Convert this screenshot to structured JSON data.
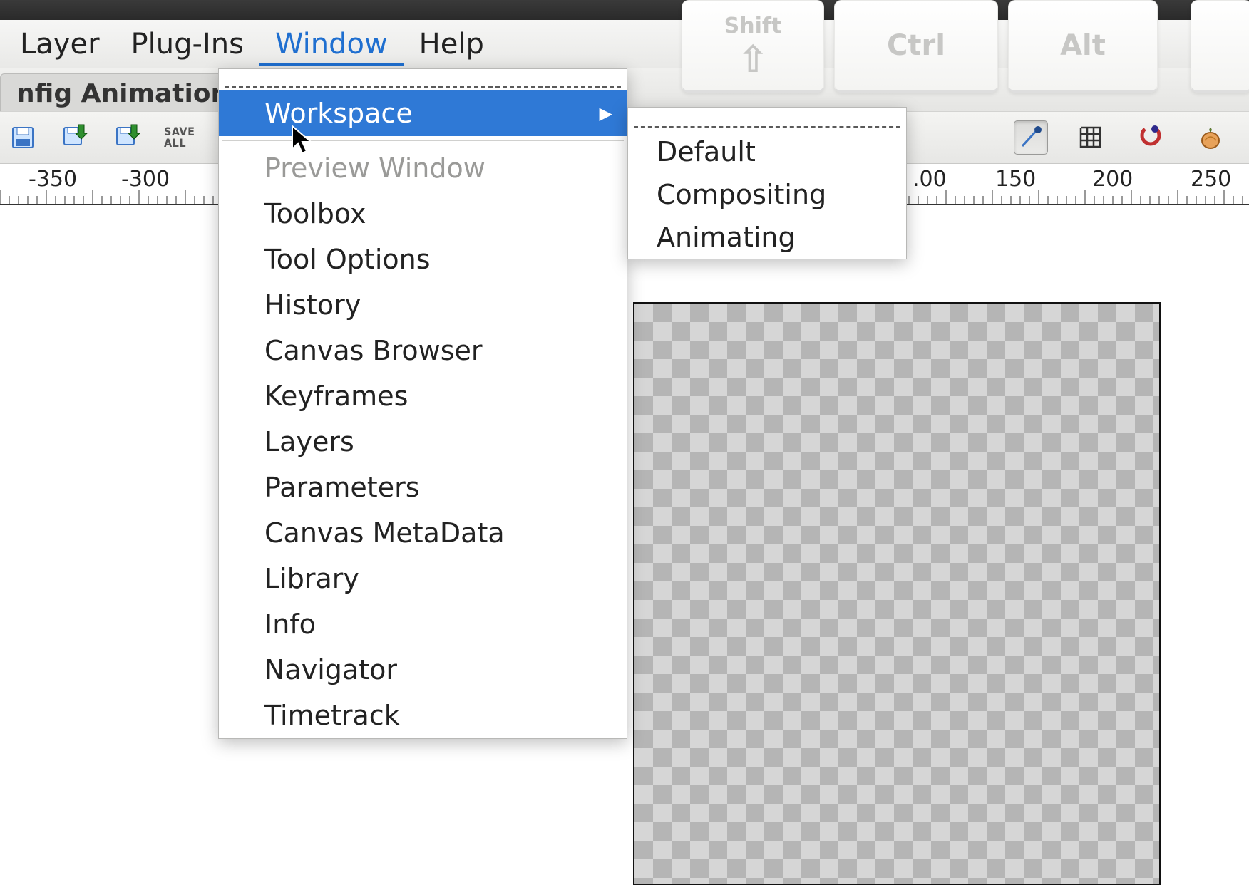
{
  "menubar": {
    "items": [
      "Layer",
      "Plug-Ins",
      "Window",
      "Help"
    ],
    "active_index": 2
  },
  "tabs": {
    "items": [
      "nfig Animation"
    ],
    "active_index": 0
  },
  "toolbar": {
    "save_all_label": "SAVE\nALL"
  },
  "modifier_keys": {
    "shift": "Shift",
    "ctrl": "Ctrl",
    "alt": "Alt"
  },
  "ruler": {
    "labels": [
      "-350",
      "-300",
      ".00",
      "150",
      "200",
      "250"
    ]
  },
  "window_menu": {
    "items": [
      {
        "label": "Workspace",
        "submenu": true,
        "highlight": true
      },
      {
        "sep": true
      },
      {
        "label": "Preview Window",
        "disabled": true
      },
      {
        "label": "Toolbox"
      },
      {
        "label": "Tool Options"
      },
      {
        "label": "History"
      },
      {
        "label": "Canvas Browser"
      },
      {
        "label": "Keyframes"
      },
      {
        "label": "Layers"
      },
      {
        "label": "Parameters"
      },
      {
        "label": "Canvas MetaData"
      },
      {
        "label": "Library"
      },
      {
        "label": "Info"
      },
      {
        "label": "Navigator"
      },
      {
        "label": "Timetrack"
      }
    ]
  },
  "workspace_submenu": {
    "items": [
      "Default",
      "Compositing",
      "Animating"
    ]
  }
}
